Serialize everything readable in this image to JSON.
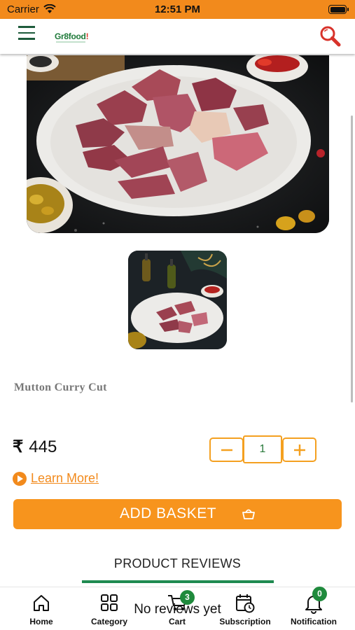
{
  "status_bar": {
    "carrier": "Carrier",
    "time": "12:51 PM"
  },
  "header": {
    "logo_text": "Gr8food",
    "logo_mark": "!"
  },
  "product": {
    "title": "Mutton Curry Cut",
    "currency_symbol": "₹",
    "price": "445",
    "quantity": "1",
    "learn_more_label": "Learn More!",
    "add_basket_label": "ADD BASKET"
  },
  "reviews": {
    "tab_label": "PRODUCT REVIEWS",
    "empty_text": "No reviews yet"
  },
  "bottom_nav": [
    {
      "label": "Home",
      "icon": "home-icon"
    },
    {
      "label": "Category",
      "icon": "grid-icon"
    },
    {
      "label": "Cart",
      "icon": "cart-icon",
      "badge": "3"
    },
    {
      "label": "Subscription",
      "icon": "calendar-clock-icon"
    },
    {
      "label": "Notification",
      "icon": "bell-icon",
      "badge": "0"
    }
  ],
  "colors": {
    "brand_orange": "#f7941d",
    "brand_green": "#1f8a3c",
    "status_bar": "#f28a1c"
  }
}
